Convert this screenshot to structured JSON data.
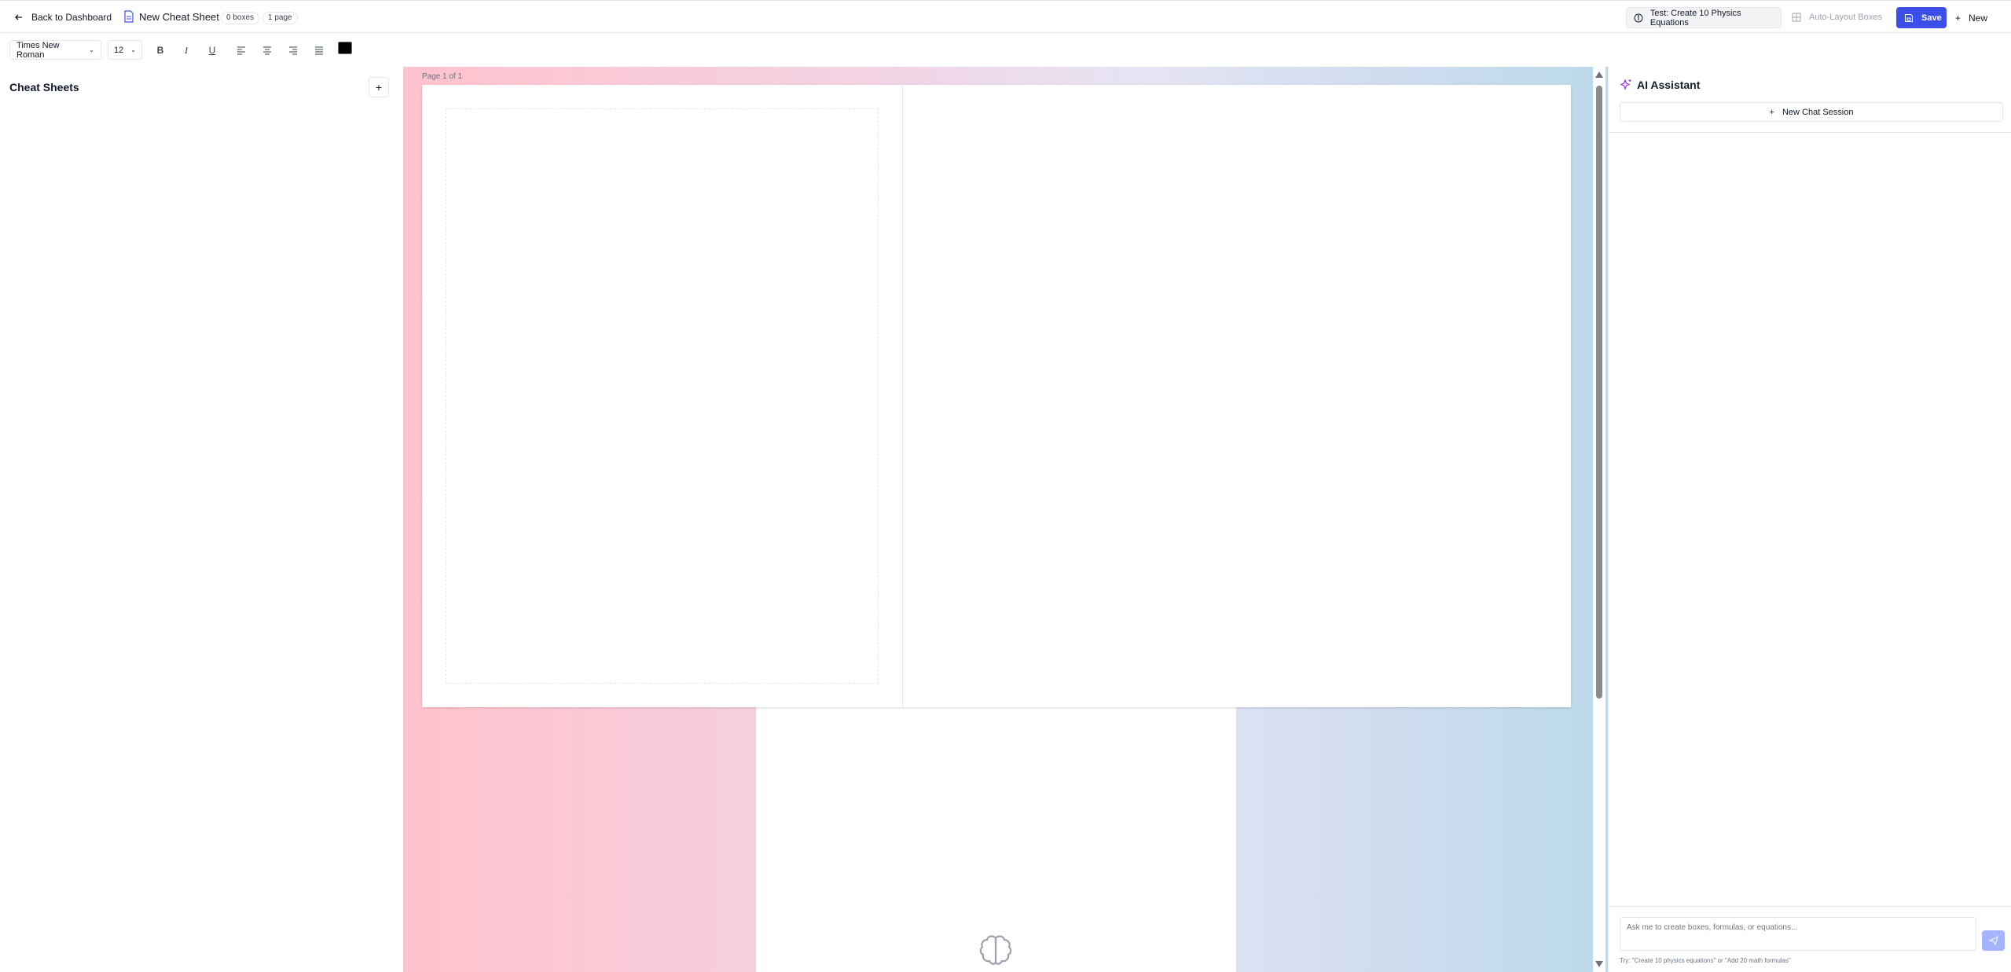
{
  "header": {
    "back_label": "Back to Dashboard",
    "doc_title": "New Cheat Sheet",
    "boxes_badge": "0 boxes",
    "pages_badge": "1 page",
    "test_label": "Test: Create 10 Physics Equations",
    "auto_layout_label": "Auto-Layout Boxes",
    "save_label": "Save",
    "new_label": "New"
  },
  "toolbar": {
    "font_family": "Times New Roman",
    "font_size": "12",
    "bold": "B",
    "italic": "I",
    "underline": "U",
    "text_color": "#000000"
  },
  "sidebar": {
    "title": "Cheat Sheets",
    "add_label": "+"
  },
  "canvas": {
    "page_label": "Page 1 of 1"
  },
  "ai": {
    "title": "AI Assistant",
    "new_chat_label": "New Chat Session",
    "input_placeholder": "Ask me to create boxes, formulas, or equations...",
    "hint": "Try: \"Create 10 physics equations\" or \"Add 20 math formulas\""
  },
  "colors": {
    "accent": "#3b4ee8",
    "send_disabled": "#a5b4fc",
    "ai_sparkle": "#9333ea"
  }
}
